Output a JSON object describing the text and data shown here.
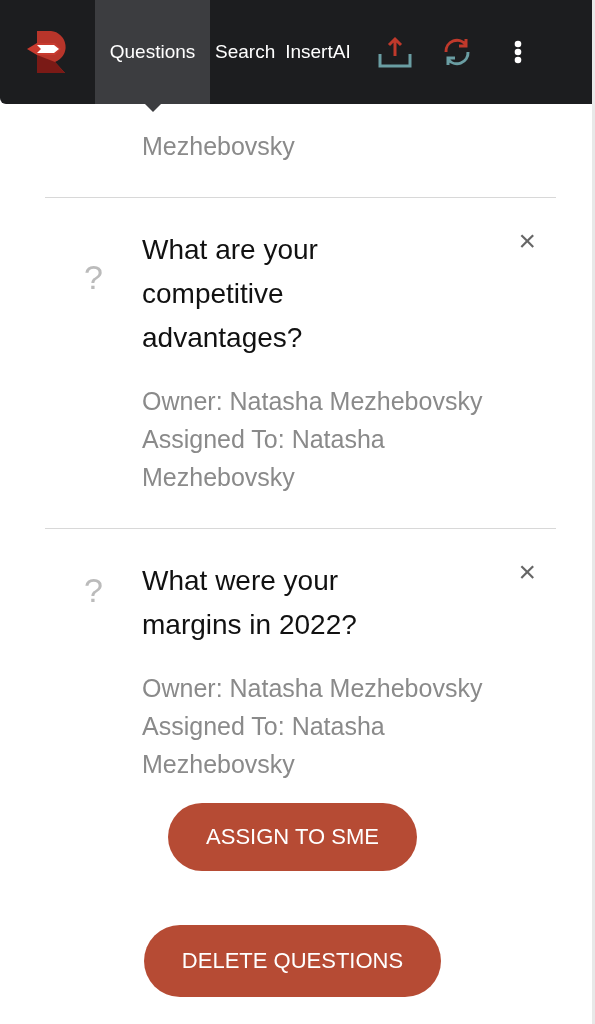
{
  "nav": {
    "tabs": [
      {
        "label": "Questions",
        "selected": true
      },
      {
        "label": "Search",
        "selected": false
      },
      {
        "label": "InsertAI",
        "selected": false
      }
    ]
  },
  "partial_question": {
    "assigned": "Mezhebovsky"
  },
  "questions": [
    {
      "mark": "?",
      "title": "What are your competitive advantages?",
      "owner": "Owner: Natasha Mezhebovsky",
      "assigned": "Assigned To: Natasha Mezhebovsky",
      "close": "×"
    },
    {
      "mark": "?",
      "title": "What were your margins in 2022?",
      "owner": "Owner: Natasha Mezhebovsky",
      "assigned": "Assigned To: Natasha Mezhebovsky",
      "close": "×"
    }
  ],
  "buttons": [
    "ASSIGN TO SME",
    "DELETE QUESTIONS"
  ]
}
